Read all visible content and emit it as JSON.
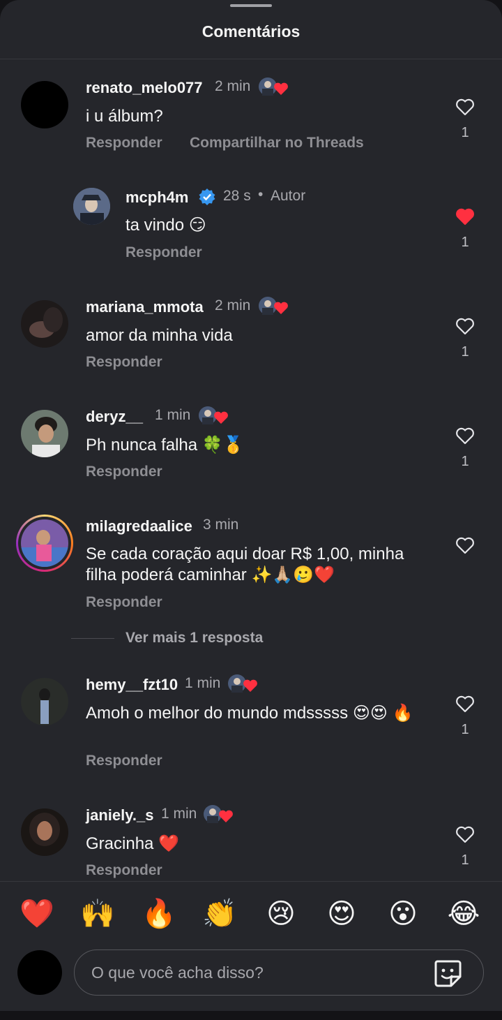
{
  "header": {
    "title": "Comentários"
  },
  "comments": [
    {
      "username": "renato_melo077",
      "time": "2 min",
      "text": "i u álbum?",
      "reply": "Responder",
      "share": "Compartilhar no Threads",
      "likes": "1",
      "liked": false
    },
    {
      "username": "mcph4m",
      "time": "28 s",
      "author_tag": "Autor",
      "text": "ta vindo 😏",
      "reply": "Responder",
      "likes": "1",
      "liked": true
    },
    {
      "username": "mariana_mmota",
      "time": "2 min",
      "text": "amor da minha vida",
      "reply": "Responder",
      "likes": "1",
      "liked": false
    },
    {
      "username": "deryz__",
      "time": "1 min",
      "text": "Ph nunca falha 🍀🥇",
      "reply": "Responder",
      "likes": "1",
      "liked": false
    },
    {
      "username": "milagredaalice",
      "time": "3 min",
      "text": "Se cada coração aqui doar R$ 1,00, minha filha poderá caminhar ✨🙏🏼🥲❤️",
      "reply": "Responder",
      "more_replies": "Ver mais 1 resposta",
      "liked": false
    },
    {
      "username": "hemy__fzt10",
      "time": "1 min",
      "text": "Amoh o melhor do mundo mdsssss 😍😍 🔥",
      "reply": "Responder",
      "likes": "1",
      "liked": false
    },
    {
      "username": "janiely._s",
      "time": "1 min",
      "text": "Gracinha ❤️",
      "reply": "Responder",
      "likes": "1",
      "liked": false
    }
  ],
  "reactions": [
    "❤️",
    "🙌",
    "🔥",
    "👏",
    "😢",
    "😍",
    "😮",
    "😂"
  ],
  "composer": {
    "placeholder": "O que você acha disso?"
  },
  "colors": {
    "background": "#25262b",
    "liked_heart": "#ff3040",
    "verified": "#3797f0"
  },
  "icons": {
    "like": "heart-outline-icon",
    "liked": "heart-filled-icon",
    "verified": "verified-badge-icon",
    "sticker": "sticker-icon"
  }
}
